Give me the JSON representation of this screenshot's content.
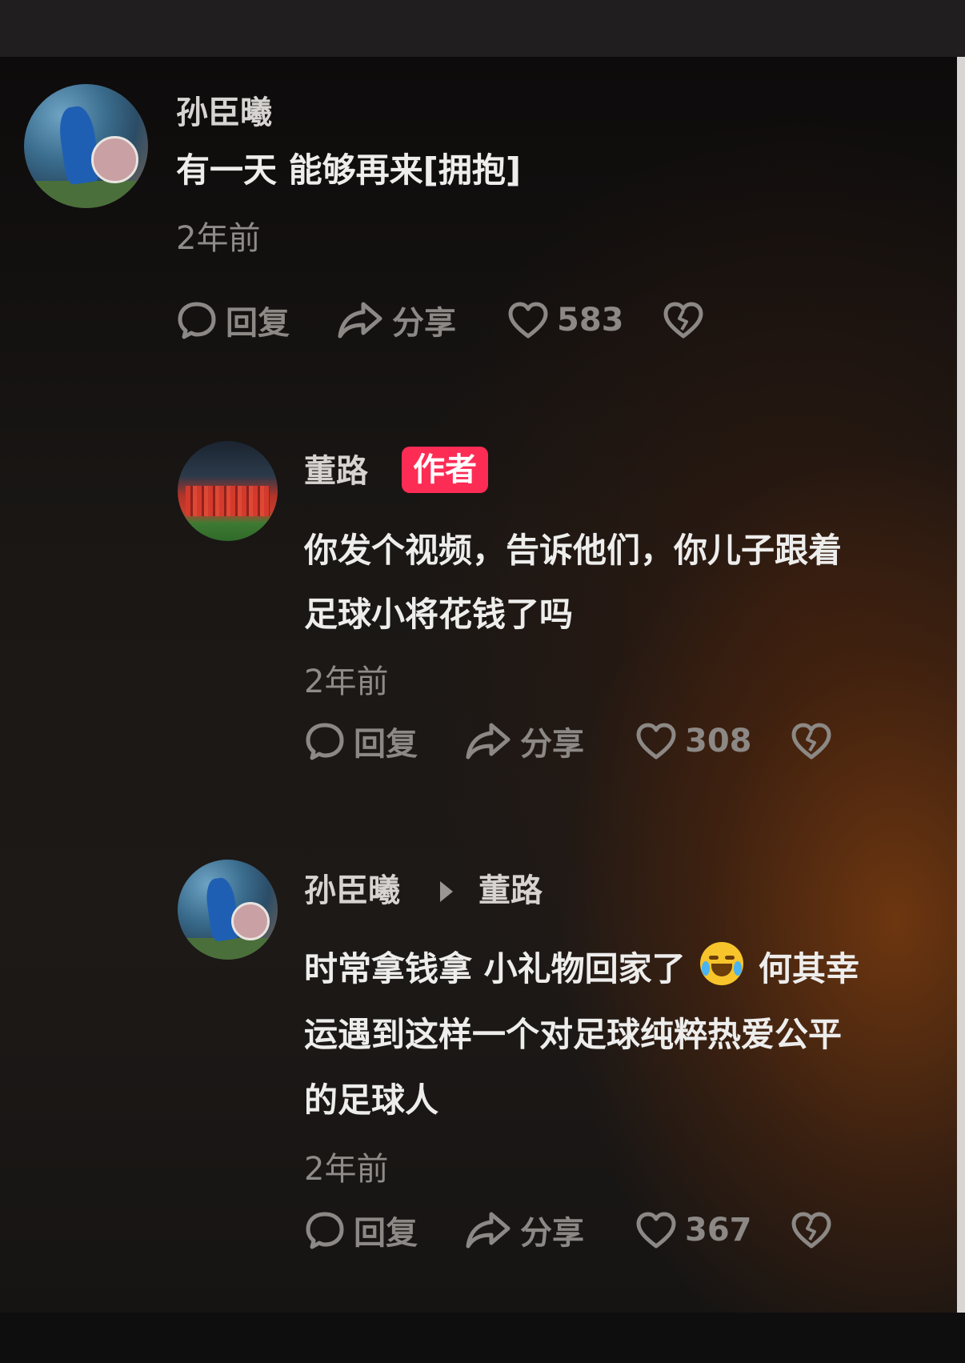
{
  "comments": [
    {
      "author": "孙臣曦",
      "avatar_icon": "user-avatar-goalkeeper",
      "text": "有一天 能够再来[拥抱]",
      "time": "2年前",
      "reply_label": "回复",
      "share_label": "分享",
      "likes": "583"
    },
    {
      "author": "董路",
      "badge": "作者",
      "avatar_icon": "user-avatar-team-photo",
      "text_line1": "你发个视频，告诉他们，你儿子跟着",
      "text_line2": "足球小将花钱了吗",
      "time": "2年前",
      "reply_label": "回复",
      "share_label": "分享",
      "likes": "308"
    },
    {
      "author": "孙臣曦",
      "reply_to": "董路",
      "avatar_icon": "user-avatar-goalkeeper",
      "text_line1_a": "时常拿钱拿 小礼物回家了",
      "emoji": "crying-laughing-emoji",
      "text_line1_b": "何其幸",
      "text_line2": "运遇到这样一个对足球纯粹热爱公平",
      "text_line3": "的足球人",
      "time": "2年前",
      "reply_label": "回复",
      "share_label": "分享",
      "likes": "367"
    }
  ],
  "colors": {
    "badge_bg": "#fc2c55",
    "text_primary": "#ededec",
    "text_secondary": "#8f8b88"
  }
}
